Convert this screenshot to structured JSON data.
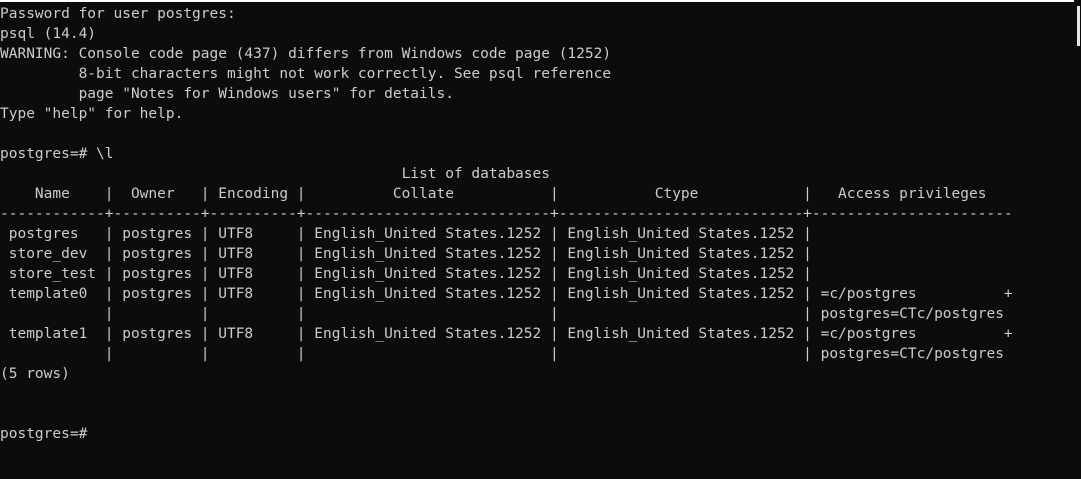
{
  "terminal": {
    "lines": [
      "Password for user postgres:",
      "psql (14.4)",
      "WARNING: Console code page (437) differs from Windows code page (1252)",
      "         8-bit characters might not work correctly. See psql reference",
      "         page \"Notes for Windows users\" for details.",
      "Type \"help\" for help.",
      "",
      "postgres=# \\l",
      "                                              List of databases",
      "    Name    |  Owner   | Encoding |          Collate           |           Ctype            |   Access privileges",
      "------------+----------+----------+----------------------------+----------------------------+-----------------------",
      " postgres   | postgres | UTF8     | English_United States.1252 | English_United States.1252 |",
      " store_dev  | postgres | UTF8     | English_United States.1252 | English_United States.1252 |",
      " store_test | postgres | UTF8     | English_United States.1252 | English_United States.1252 |",
      " template0  | postgres | UTF8     | English_United States.1252 | English_United States.1252 | =c/postgres          +",
      "            |          |          |                            |                            | postgres=CTc/postgres",
      " template1  | postgres | UTF8     | English_United States.1252 | English_United States.1252 | =c/postgres          +",
      "            |          |          |                            |                            | postgres=CTc/postgres",
      "(5 rows)",
      "",
      "",
      "postgres=#"
    ]
  }
}
